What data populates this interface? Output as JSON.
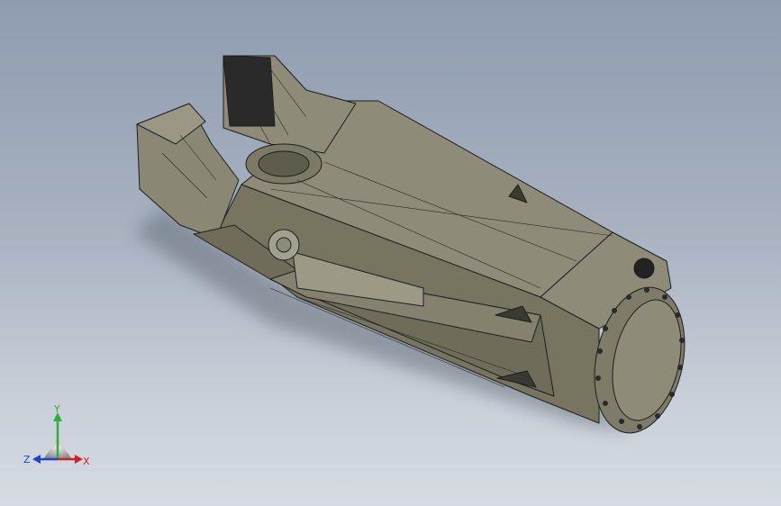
{
  "viewport": {
    "background_top": "#8f9cb0",
    "background_bottom": "#d6dbe2",
    "model_color": "#8e8c78",
    "edge_color": "#1e1e1e"
  },
  "triad": {
    "y_label": "Y",
    "x_label": "X",
    "z_label": "Z",
    "y_color": "#2eae3a",
    "x_color": "#d02020",
    "z_color": "#2040d0"
  }
}
